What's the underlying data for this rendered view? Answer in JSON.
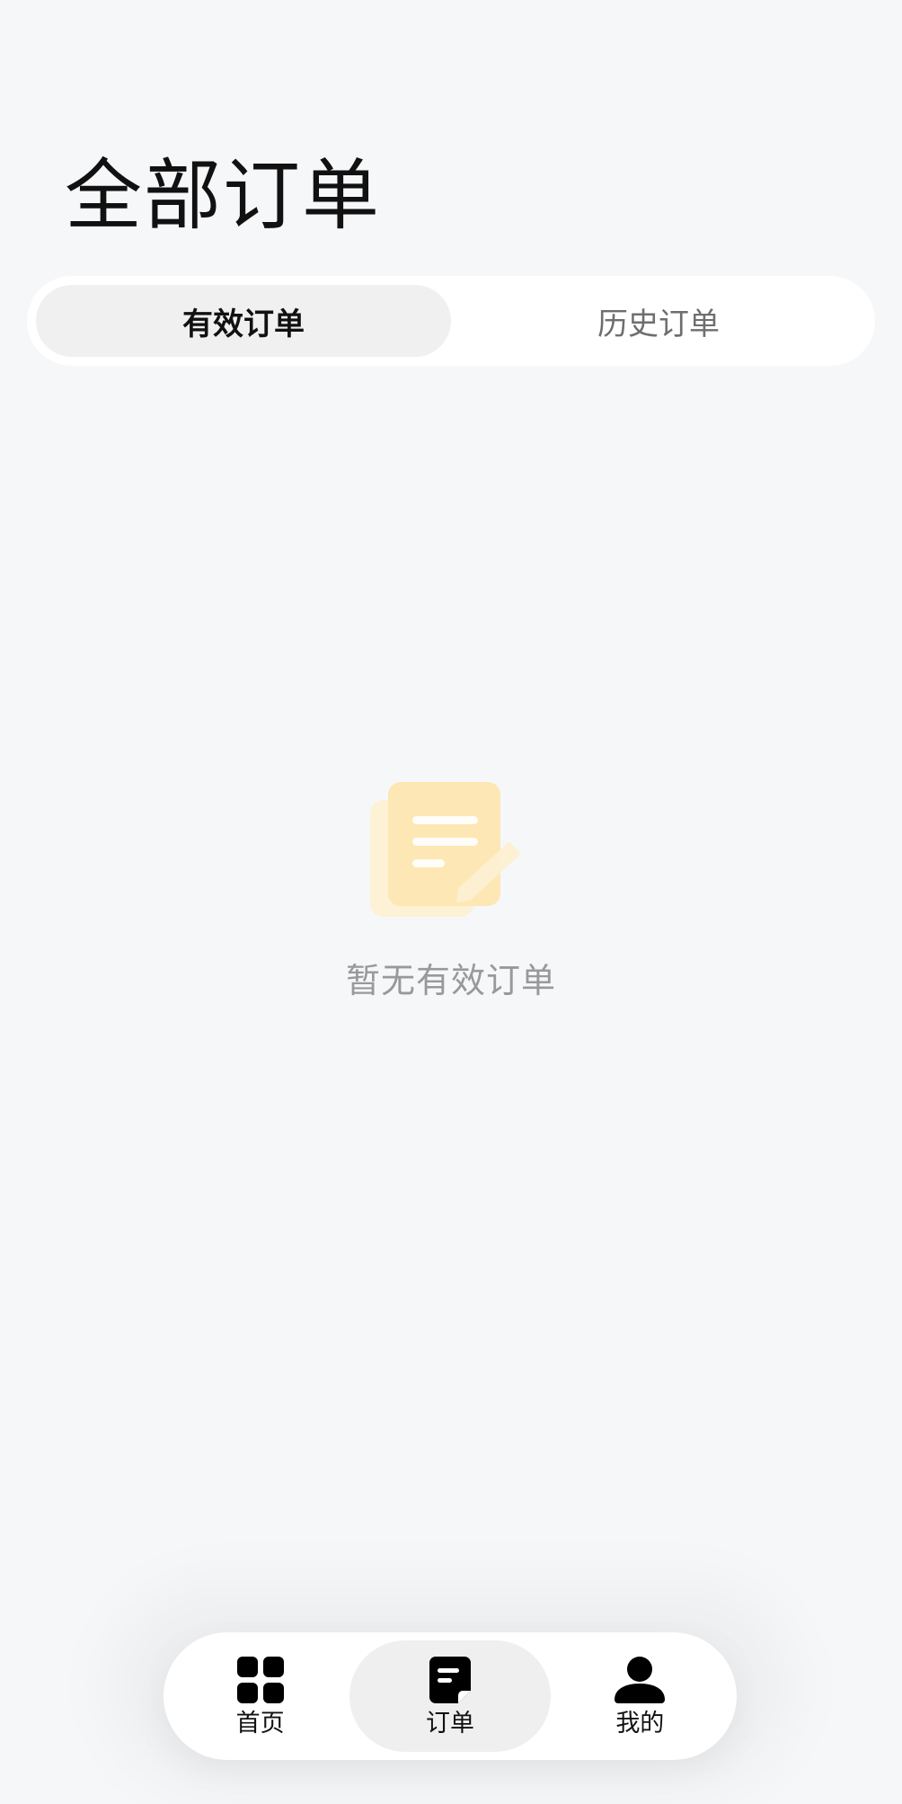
{
  "page": {
    "title": "全部订单"
  },
  "tabs": [
    {
      "label": "有效订单",
      "active": true
    },
    {
      "label": "历史订单",
      "active": false
    }
  ],
  "empty_state": {
    "icon": "order-document-icon",
    "message": "暂无有效订单"
  },
  "bottom_nav": {
    "items": [
      {
        "label": "首页",
        "icon": "grid-icon",
        "active": false
      },
      {
        "label": "订单",
        "icon": "order-icon",
        "active": true
      },
      {
        "label": "我的",
        "icon": "user-icon",
        "active": false
      }
    ]
  },
  "colors": {
    "background": "#f6f7f9",
    "surface": "#ffffff",
    "active_pill": "#f0f0f0",
    "text_primary": "#111111",
    "text_secondary": "#6e6e6e",
    "text_muted": "#999999",
    "illustration_accent": "#fde7b4"
  }
}
